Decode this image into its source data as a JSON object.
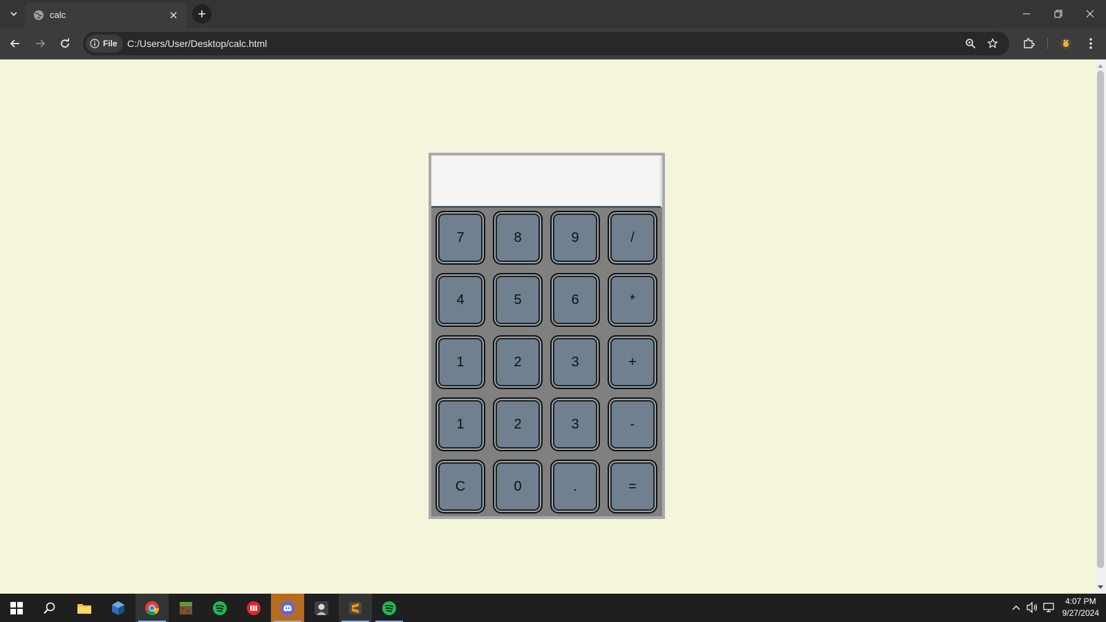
{
  "browser": {
    "tab": {
      "title": "calc",
      "favicon": "globe-icon"
    },
    "site_chip_label": "File",
    "url": "C:/Users/User/Desktop/calc.html"
  },
  "calculator": {
    "display_value": "",
    "keys": [
      "7",
      "8",
      "9",
      "/",
      "4",
      "5",
      "6",
      "*",
      "1",
      "2",
      "3",
      "+",
      "1",
      "2",
      "3",
      "-",
      "C",
      "0",
      ".",
      "="
    ]
  },
  "taskbar": {
    "apps": [
      "windows-start-icon",
      "search-icon",
      "file-explorer-icon",
      "virtualbox-icon",
      "chrome-icon",
      "minecraft-icon",
      "spotify-icon",
      "ticket-app-icon",
      "discord-icon",
      "game-character-icon",
      "sublime-text-icon",
      "spotify-icon"
    ],
    "time": "4:07 PM",
    "date": "9/27/2024"
  },
  "colors": {
    "page_background": "#f5f5dc",
    "calculator_body": "#808080",
    "key_fill": "#708090",
    "display_fill": "#f5f5f5"
  }
}
